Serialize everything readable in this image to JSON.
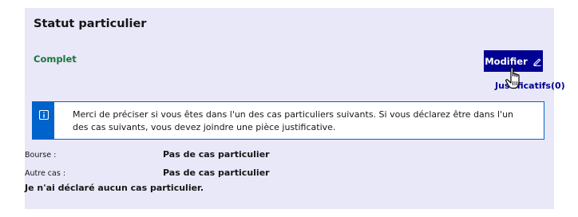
{
  "section": {
    "title": "Statut particulier",
    "status": "Complet",
    "colors": {
      "card_bg": "#e8e8f8",
      "status_green": "#18753c",
      "primary": "#000091",
      "info_blue": "#0063cb"
    }
  },
  "actions": {
    "modify_label": "Modifier",
    "modify_icon": "pencil-icon",
    "justificatifs_label": "Justificatifs(0)"
  },
  "alert": {
    "icon": "info-icon",
    "text": "Merci de préciser si vous êtes dans l'un des cas particuliers suivants. Si vous déclarez être dans l'un des cas suivants, vous devez joindre une pièce justificative."
  },
  "fields": [
    {
      "label": "Bourse :",
      "value": "Pas de cas particulier"
    },
    {
      "label": "Autre cas :",
      "value": "Pas de cas particulier"
    }
  ],
  "note": "Je n'ai déclaré aucun cas particulier."
}
